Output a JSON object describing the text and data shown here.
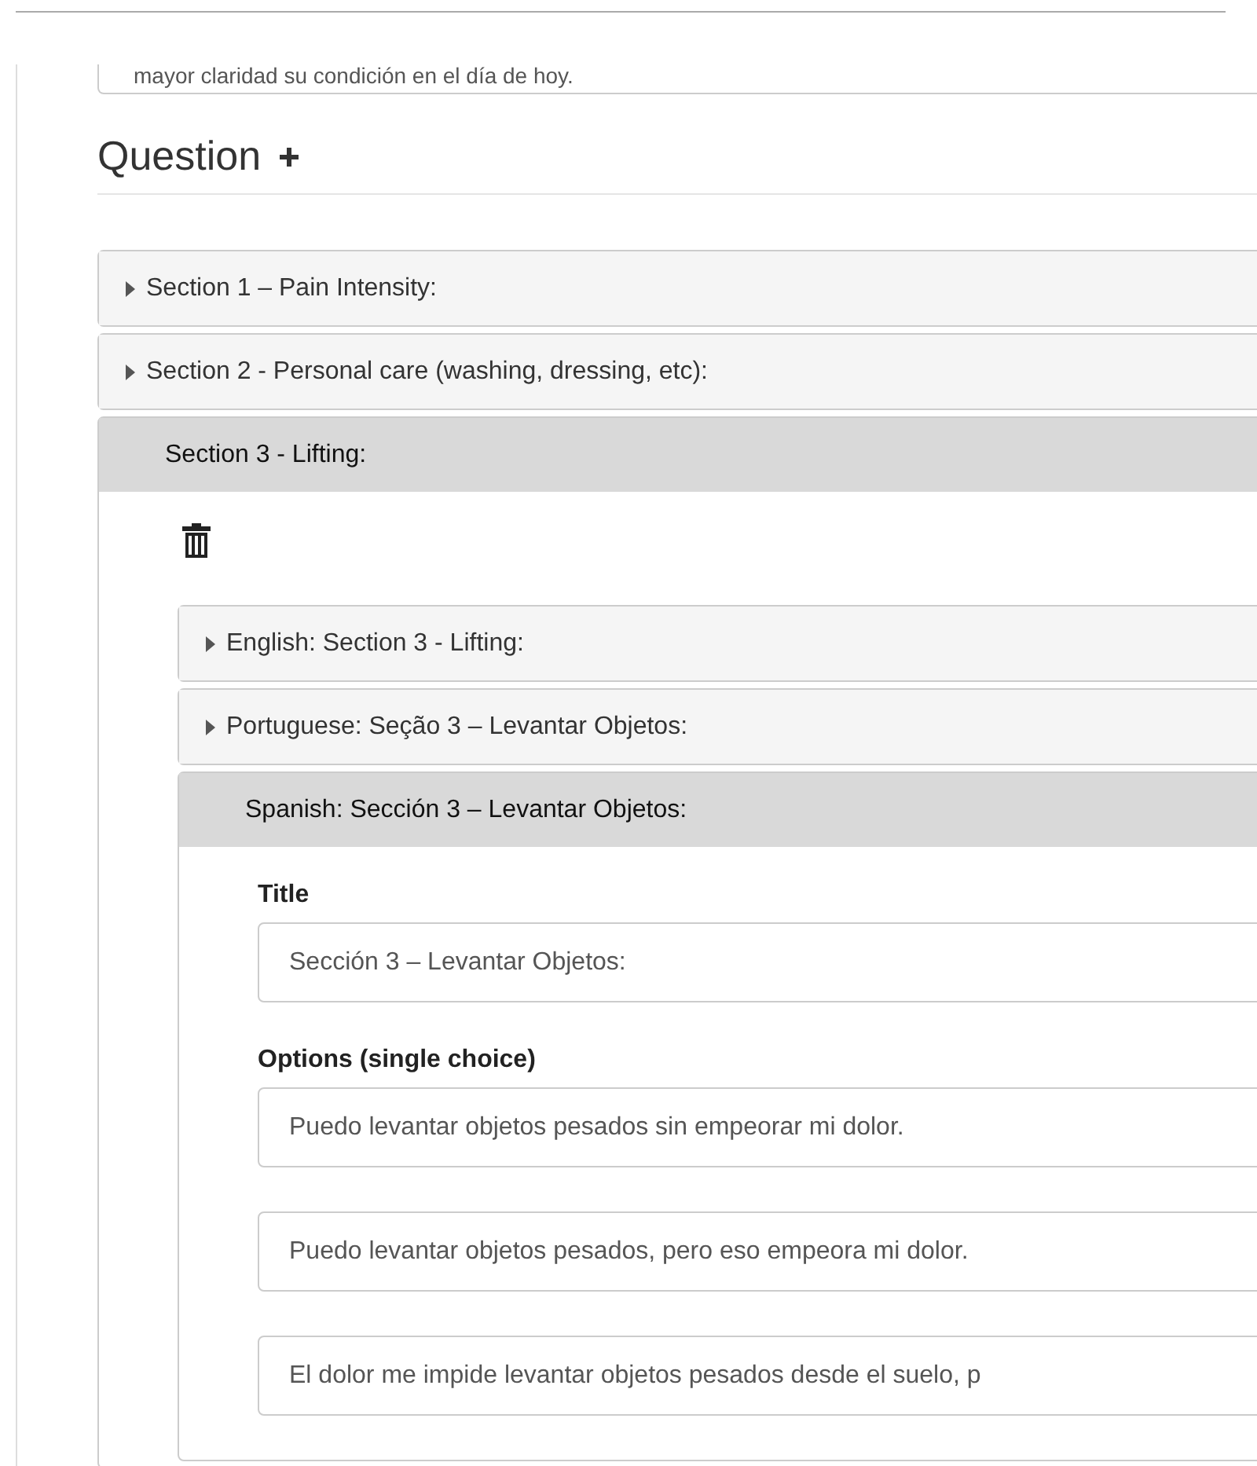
{
  "intro_field": {
    "value": "mayor claridad su condición en el día de hoy."
  },
  "heading": "Question",
  "sections": [
    {
      "title": "Section 1 – Pain Intensity:",
      "expanded": false
    },
    {
      "title": "Section 2 - Personal care (washing, dressing, etc):",
      "expanded": false
    },
    {
      "title": "Section 3 - Lifting:",
      "expanded": true,
      "languages": [
        {
          "title": "English: Section 3 - Lifting:",
          "expanded": false
        },
        {
          "title": "Portuguese: Seção 3 – Levantar Objetos:",
          "expanded": false
        },
        {
          "title": "Spanish: Sección 3 – Levantar Objetos:",
          "expanded": true,
          "title_label": "Title",
          "title_value": "Sección 3 – Levantar Objetos:",
          "options_label": "Options (single choice)",
          "options": [
            "Puedo levantar objetos pesados sin empeorar mi dolor.",
            "Puedo levantar objetos pesados, pero eso empeora mi dolor.",
            "El dolor me impide levantar objetos pesados desde el suelo, p"
          ]
        }
      ]
    }
  ]
}
